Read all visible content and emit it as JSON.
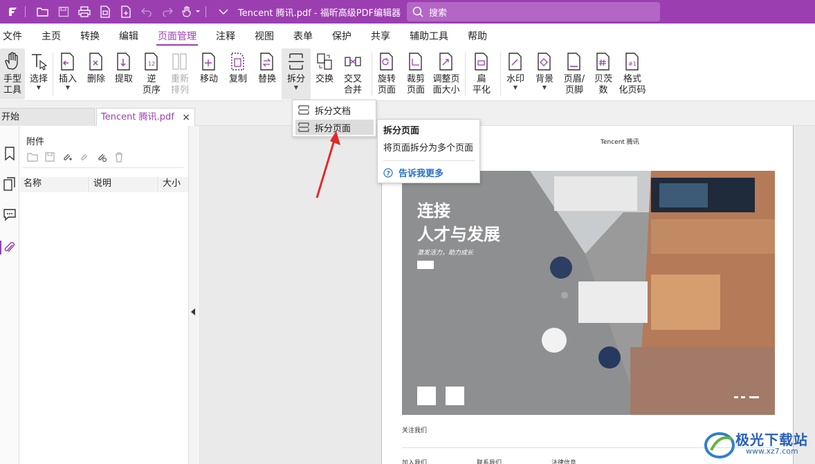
{
  "app": {
    "document_title": "Tencent 腾讯.pdf - 福昕高级PDF编辑器",
    "search_placeholder": "搜索",
    "accent_color": "#9b3fb0"
  },
  "menu": [
    "文件",
    "主页",
    "转换",
    "编辑",
    "页面管理",
    "注释",
    "视图",
    "表单",
    "保护",
    "共享",
    "辅助工具",
    "帮助"
  ],
  "menu_active": "页面管理",
  "ribbon": {
    "hand_tool": [
      "手型",
      "工具"
    ],
    "select": "选择",
    "insert": "插入",
    "delete": "删除",
    "extract": "提取",
    "reverse": [
      "逆",
      "页序"
    ],
    "reorder": [
      "重新",
      "排列"
    ],
    "move": "移动",
    "copy": "复制",
    "replace": "替换",
    "split": "拆分",
    "swap": "交换",
    "interleave": [
      "交叉",
      "合并"
    ],
    "rotate": [
      "旋转",
      "页面"
    ],
    "crop": [
      "裁剪",
      "页面"
    ],
    "resize": [
      "调整页",
      "面大小"
    ],
    "flatten": [
      "扁",
      "平化"
    ],
    "watermark": "水印",
    "background": "背景",
    "header_footer": [
      "页眉/",
      "页脚"
    ],
    "bates": [
      "贝茨",
      "数"
    ],
    "format_page_number": [
      "格式",
      "化页码"
    ]
  },
  "tabs": {
    "start": "开始",
    "doc": "Tencent 腾讯.pdf",
    "close": "×"
  },
  "panel": {
    "title": "附件",
    "columns": [
      "名称",
      "说明",
      "大小"
    ]
  },
  "dropdown": {
    "split_document": "拆分文档",
    "split_page": "拆分页面"
  },
  "tooltip": {
    "title": "拆分页面",
    "description": "将页面拆分为多个页面",
    "learn_more": "告诉我更多"
  },
  "page": {
    "header": "Tencent 腾讯",
    "title_line1": "连接",
    "title_line2": "人才与发展",
    "subtitle": "激发活力，助力成长",
    "follow_us": "关注我们",
    "footer_links": [
      "加入我们",
      "联系我们",
      "法律信息"
    ]
  },
  "watermark": {
    "name": "极光下载站",
    "url": "www.xz7.com"
  }
}
